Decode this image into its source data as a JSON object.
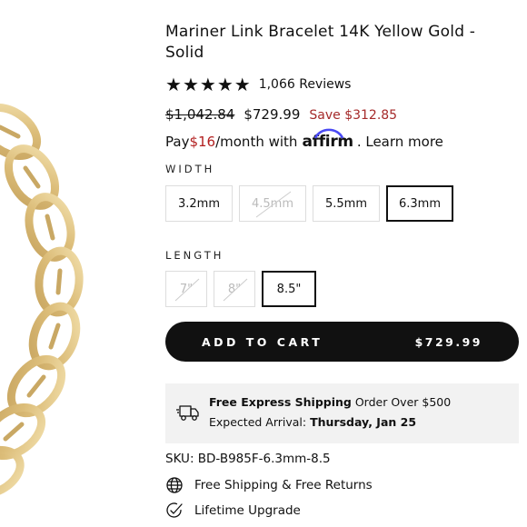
{
  "product": {
    "title": "Mariner Link Bracelet 14K Yellow Gold - Solid",
    "rating": 5,
    "reviews": "1,066 Reviews",
    "original_price": "$1,042.84",
    "price": "$729.99",
    "savings": "Save $312.85"
  },
  "financing": {
    "prefix": "Pay ",
    "amount": "$16",
    "suffix": "/month with ",
    "provider": "affirm",
    "link": ". Learn more"
  },
  "width": {
    "label": "WIDTH",
    "options": [
      {
        "label": "3.2mm",
        "state": "available"
      },
      {
        "label": "4.5mm",
        "state": "unavailable"
      },
      {
        "label": "5.5mm",
        "state": "available"
      },
      {
        "label": "6.3mm",
        "state": "selected"
      }
    ]
  },
  "length": {
    "label": "LENGTH",
    "options": [
      {
        "label": "7\"",
        "state": "unavailable"
      },
      {
        "label": "8\"",
        "state": "unavailable"
      },
      {
        "label": "8.5\"",
        "state": "selected"
      }
    ]
  },
  "cart": {
    "label": "ADD TO CART",
    "price": "$729.99"
  },
  "shipping": {
    "title": "Free Express Shipping",
    "condition": " Order Over $500",
    "arrival_label": "Expected Arrival: ",
    "arrival_date": "Thursday, Jan 25"
  },
  "sku": "SKU: BD-B985F-6.3mm-8.5",
  "features": [
    {
      "label": "Free Shipping & Free Returns",
      "icon": "globe-icon"
    },
    {
      "label": "Lifetime Upgrade",
      "icon": "check-badge-icon"
    }
  ],
  "colors": {
    "gold": "#e3c98a",
    "gold_dark": "#c9a864",
    "accent_red": "#a52a2a",
    "cart_bg": "#111111",
    "ship_bg": "#f2f2f2"
  }
}
